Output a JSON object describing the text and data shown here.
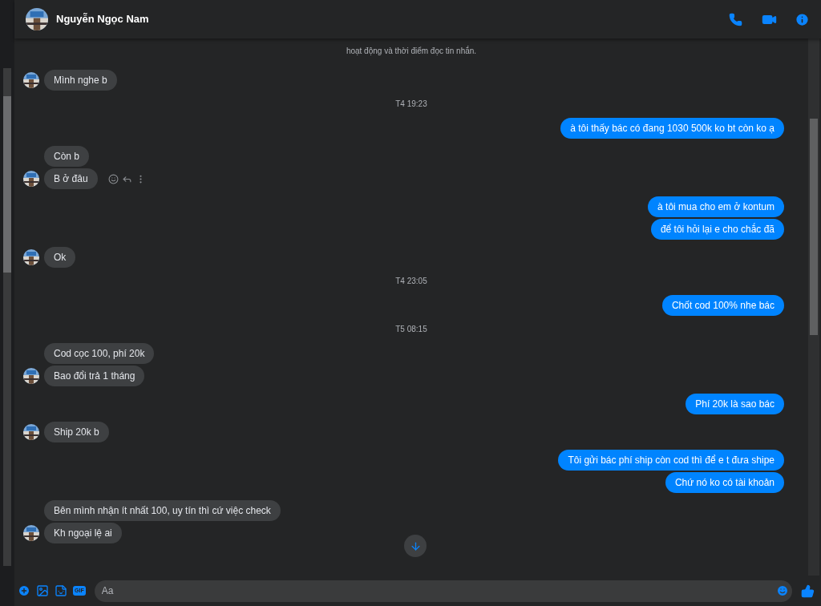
{
  "header": {
    "name": "Nguyễn Ngọc Nam"
  },
  "notice": "hoạt động và thời điểm đọc tin nhắn.",
  "messages": [
    {
      "kind": "in",
      "text": "Mình nghe b",
      "avatar": true,
      "actions": false
    },
    {
      "kind": "time",
      "text": "T4 19:23"
    },
    {
      "kind": "out",
      "text": "à tôi thấy bác có đang 1030 500k ko bt còn ko ạ"
    },
    {
      "kind": "in",
      "text": "Còn b",
      "avatar": false,
      "actions": false
    },
    {
      "kind": "in",
      "text": "B ở đâu",
      "avatar": true,
      "actions": true
    },
    {
      "kind": "out",
      "text": "à tôi mua cho em ở kontum"
    },
    {
      "kind": "out",
      "text": "để tôi hỏi lại e cho chắc đã"
    },
    {
      "kind": "in",
      "text": "Ok",
      "avatar": true,
      "actions": false
    },
    {
      "kind": "time",
      "text": "T4 23:05"
    },
    {
      "kind": "out",
      "text": "Chốt cod 100% nhe bác"
    },
    {
      "kind": "time",
      "text": "T5 08:15"
    },
    {
      "kind": "in",
      "text": "Cod cọc 100, phí 20k",
      "avatar": false,
      "actions": false
    },
    {
      "kind": "in",
      "text": "Bao đổi trả 1 tháng",
      "avatar": true,
      "actions": false
    },
    {
      "kind": "out",
      "text": "Phí 20k là sao bác"
    },
    {
      "kind": "in",
      "text": "Ship 20k b",
      "avatar": true,
      "actions": false
    },
    {
      "kind": "out",
      "text": "Tôi gửi bác phí ship còn cod thì để e t đưa shipe"
    },
    {
      "kind": "out",
      "text": "Chứ nó ko có tài khoản"
    },
    {
      "kind": "in",
      "text": "Bên mình nhận ít nhất 100, uy tín thì cứ việc check",
      "avatar": false,
      "actions": false
    },
    {
      "kind": "in",
      "text": "Kh ngoại lệ ai",
      "avatar": true,
      "actions": false
    }
  ],
  "composer": {
    "placeholder": "Aa",
    "gif_label": "GIF"
  }
}
